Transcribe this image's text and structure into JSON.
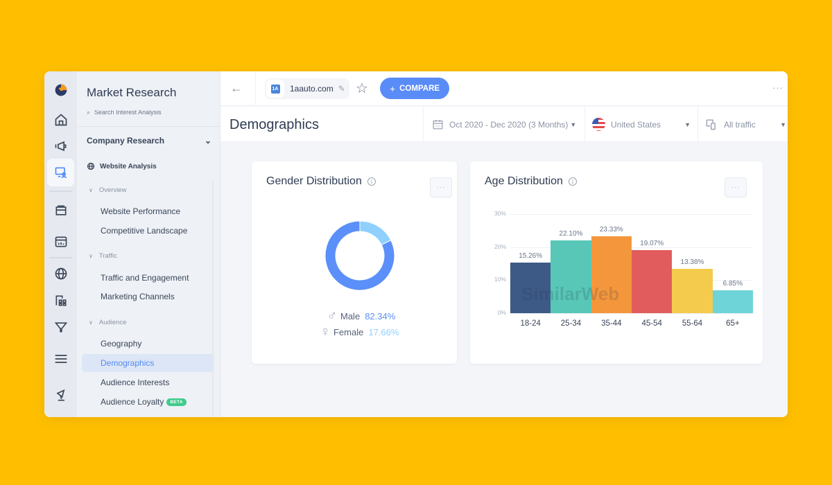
{
  "app": {
    "nav_title": "Market Research",
    "nav_cutoff_item": "Search Interest Analysis",
    "section": "Company Research",
    "subsection": "Website Analysis",
    "groups": [
      {
        "label": "Overview",
        "items": [
          "Website Performance",
          "Competitive Landscape"
        ]
      },
      {
        "label": "Traffic",
        "items": [
          "Traffic and Engagement",
          "Marketing Channels"
        ]
      },
      {
        "label": "Audience",
        "items": [
          "Geography",
          "Demographics",
          "Audience Interests",
          "Audience Loyalty"
        ]
      }
    ],
    "active_item": "Demographics",
    "beta_label": "BETA",
    "rail_icons": [
      "logo-icon",
      "home-icon",
      "megaphone-icon",
      "website-analysis-icon",
      "inbox-icon",
      "dashboard-icon",
      "globe-icon",
      "apps-icon",
      "funnel-icon",
      "menu-icon",
      "satellite-icon"
    ]
  },
  "topbar": {
    "site": "1aauto.com",
    "favicon_text": "1A",
    "compare_label": "COMPARE",
    "more": "···"
  },
  "header": {
    "title": "Demographics",
    "date_range": "Oct 2020 - Dec 2020 (3 Months)",
    "country": "United States",
    "traffic": "All traffic"
  },
  "gender_card": {
    "title": "Gender Distribution",
    "more": "···",
    "male_label": "Male",
    "male_value": "82.34%",
    "female_label": "Female",
    "female_value": "17.66%"
  },
  "age_card": {
    "title": "Age Distribution",
    "more": "···",
    "watermark": "SimilarWeb"
  },
  "colors": {
    "accent": "#5A8CF8",
    "male": "#5B8FF9",
    "female": "#8FD0FF",
    "background": "#FFBF00"
  },
  "chart_data": [
    {
      "type": "pie",
      "title": "Gender Distribution",
      "categories": [
        "Male",
        "Female"
      ],
      "values": [
        82.34,
        17.66
      ],
      "colors": [
        "#5B8FF9",
        "#8FD0FF"
      ],
      "donut": true
    },
    {
      "type": "bar",
      "title": "Age Distribution",
      "categories": [
        "18-24",
        "25-34",
        "35-44",
        "45-54",
        "55-64",
        "65+"
      ],
      "values": [
        15.26,
        22.1,
        23.33,
        19.07,
        13.38,
        6.85
      ],
      "labels": [
        "15.26%",
        "22.10%",
        "23.33%",
        "19.07%",
        "13.38%",
        "6.85%"
      ],
      "colors": [
        "#3D5A87",
        "#58C7B7",
        "#F4973C",
        "#E15D5D",
        "#F4CB4D",
        "#6FD4D8"
      ],
      "yticks": [
        "0%",
        "10%",
        "20%",
        "30%"
      ],
      "ylim": [
        0,
        30
      ],
      "grid": true,
      "xlabel": "",
      "ylabel": ""
    }
  ]
}
